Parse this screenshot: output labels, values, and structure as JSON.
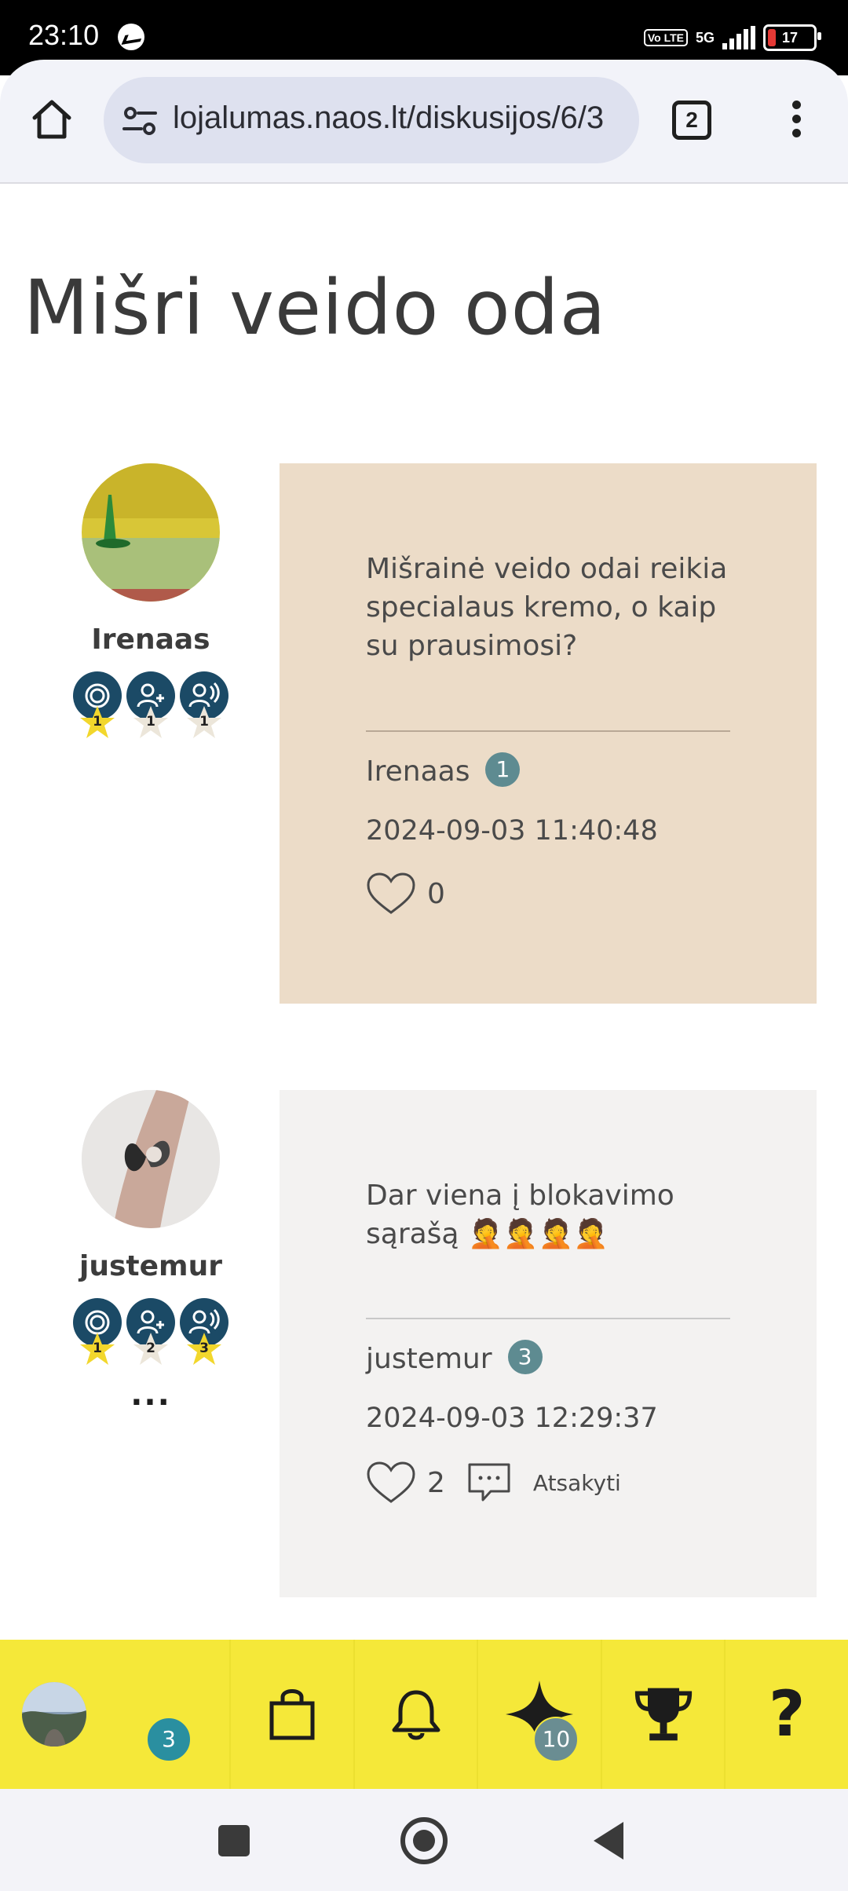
{
  "status_bar": {
    "time": "23:10",
    "network": "5G",
    "volte": "Vo LTE",
    "battery": "17"
  },
  "browser": {
    "url": "lojalumas.naos.lt/diskusijos/6/3",
    "tab_count": "2"
  },
  "page": {
    "title": "Mišri veido oda"
  },
  "posts": [
    {
      "author": "Irenaas",
      "badges": [
        "1",
        "1",
        "1"
      ],
      "text": "Mišrainė veido odai reikia specialaus kremo, o kaip su prausimosi?",
      "meta_name": "Irenaas",
      "meta_count": "1",
      "date": "2024-09-03 11:40:48",
      "likes": "0",
      "card_color": "#ecdcc8"
    },
    {
      "author": "justemur",
      "badges": [
        "1",
        "2",
        "3"
      ],
      "more": "...",
      "text": "Dar viena į blokavimo sąrašą 🤦🤦🤦🤦",
      "meta_name": "justemur",
      "meta_count": "3",
      "date": "2024-09-03 12:29:37",
      "likes": "2",
      "reply_label": "Atsakyti",
      "card_color": "#f3f2f1"
    }
  ],
  "bottom_nav": {
    "profile_badge": "3",
    "stars_badge": "10",
    "help_label": "?"
  },
  "colors": {
    "nav_bg": "#f5e839",
    "badge_navy": "#1b4a66",
    "count_badge": "#5e8b91",
    "nav_badge": "#2a8fa0"
  }
}
